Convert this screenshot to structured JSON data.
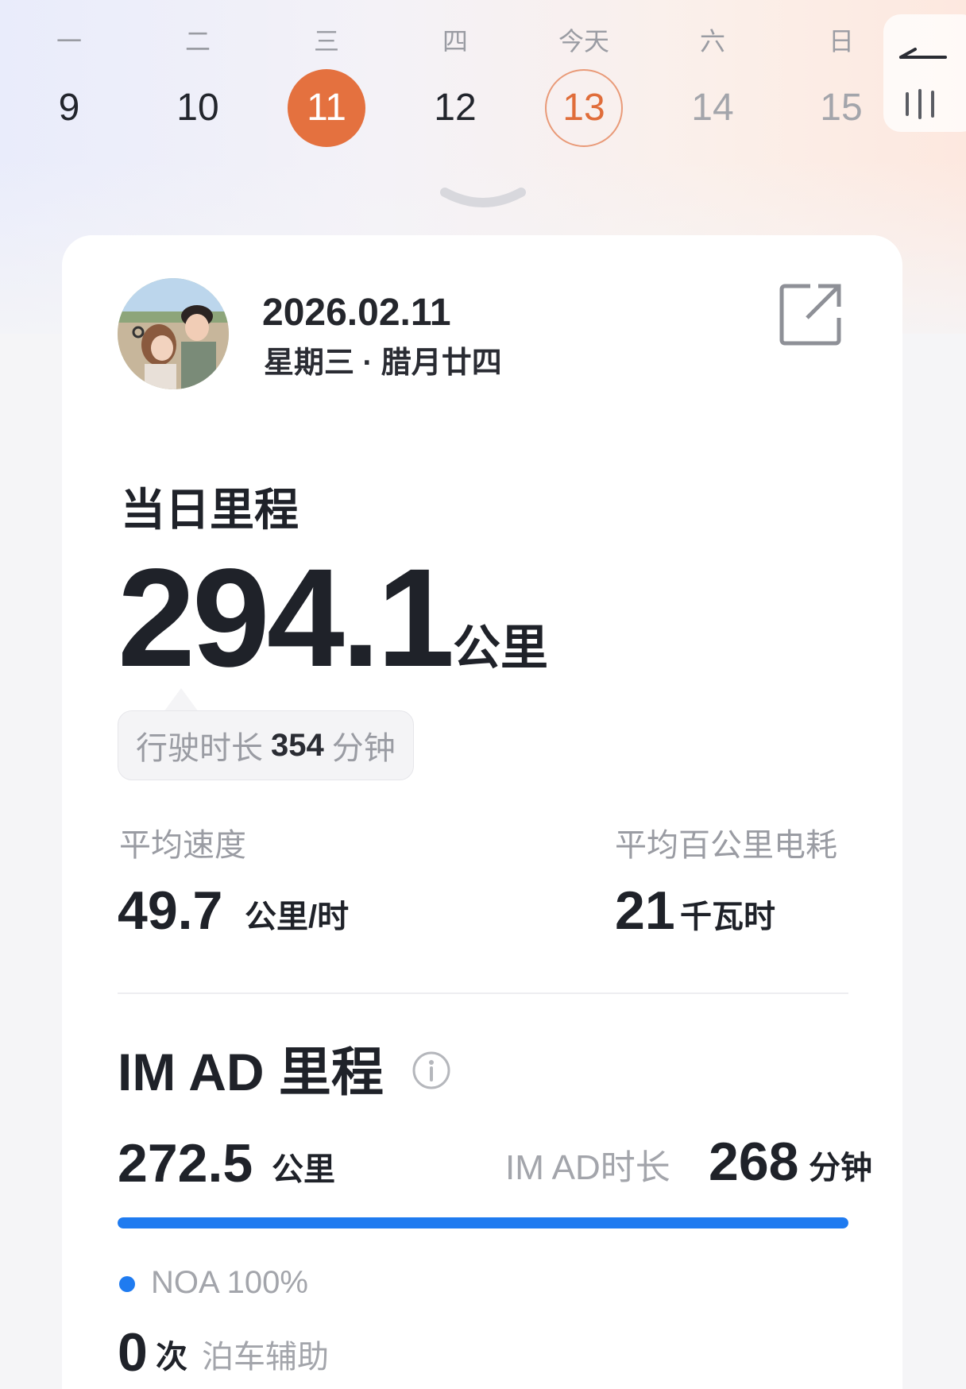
{
  "week": {
    "days": [
      {
        "weekday": "一",
        "date": "9",
        "state": "past"
      },
      {
        "weekday": "二",
        "date": "10",
        "state": "past"
      },
      {
        "weekday": "三",
        "date": "11",
        "state": "selected"
      },
      {
        "weekday": "四",
        "date": "12",
        "state": "past"
      },
      {
        "weekday": "今天",
        "date": "13",
        "state": "today"
      },
      {
        "weekday": "六",
        "date": "14",
        "state": "future"
      },
      {
        "weekday": "日",
        "date": "15",
        "state": "future"
      }
    ],
    "accent_color": "#e4713f"
  },
  "header": {
    "date": "2026.02.11",
    "subtitle": "星期三 · 腊月廿四"
  },
  "daily_mileage": {
    "title": "当日里程",
    "value": "294.1",
    "unit": "公里",
    "drive_time_label": "行驶时长",
    "drive_time_value": "354",
    "drive_time_unit": "分钟"
  },
  "stats": {
    "avg_speed_label": "平均速度",
    "avg_speed_value": "49.7",
    "avg_speed_unit": "公里/时",
    "consumption_label": "平均百公里电耗",
    "consumption_value": "21",
    "consumption_unit": "千瓦时"
  },
  "im_ad": {
    "title": "IM AD 里程",
    "mileage_value": "272.5",
    "mileage_unit": "公里",
    "duration_label": "IM AD时长",
    "duration_value": "268",
    "duration_unit": "分钟",
    "noa_share": 1.0,
    "bar_color": "#1f7bf0",
    "legend_text": "NOA 100%",
    "parking_value": "0",
    "parking_unit": "次",
    "parking_label": "泊车辅助"
  }
}
